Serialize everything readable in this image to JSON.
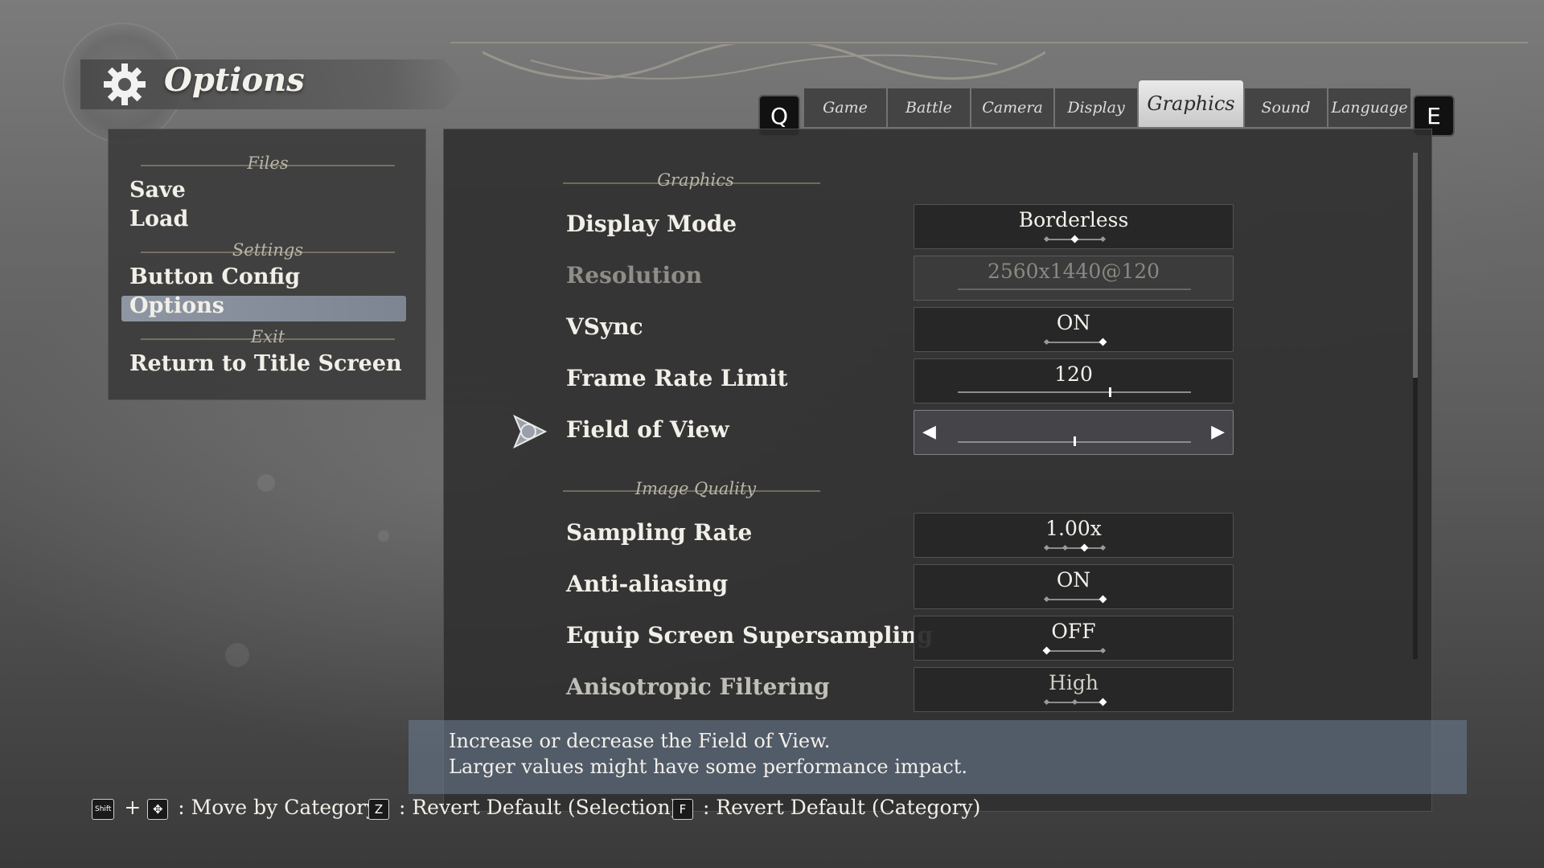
{
  "header": {
    "title": "Options",
    "icon": "gear-icon"
  },
  "side_menu": {
    "sections": {
      "files": "Files",
      "settings": "Settings",
      "exit": "Exit"
    },
    "items": {
      "save": "Save",
      "load": "Load",
      "button_config": "Button Config",
      "options": "Options",
      "return_title": "Return to Title Screen"
    },
    "selected": "Options"
  },
  "tabs": {
    "prev_key": "Q",
    "next_key": "E",
    "items": [
      "Game",
      "Battle",
      "Camera",
      "Display",
      "Graphics",
      "Sound",
      "Language"
    ],
    "active": "Graphics"
  },
  "main": {
    "groups": {
      "graphics": "Graphics",
      "image_quality": "Image Quality"
    },
    "settings": {
      "display_mode": {
        "label": "Display Mode",
        "value": "Borderless",
        "options_count": 3,
        "selected_index": 1
      },
      "resolution": {
        "label": "Resolution",
        "value": "2560x1440@120",
        "enabled": false
      },
      "vsync": {
        "label": "VSync",
        "value": "ON",
        "options_count": 2,
        "selected_index": 1
      },
      "frame_rate_limit": {
        "label": "Frame Rate Limit",
        "value": "120",
        "level": 0.65
      },
      "field_of_view": {
        "label": "Field of View",
        "level": 0.5
      },
      "sampling_rate": {
        "label": "Sampling Rate",
        "value": "1.00x",
        "options_count": 4,
        "selected_index": 2
      },
      "anti_aliasing": {
        "label": "Anti-aliasing",
        "value": "ON",
        "options_count": 2,
        "selected_index": 1
      },
      "equip_supersampling": {
        "label": "Equip Screen Supersampling",
        "value": "OFF",
        "options_count": 2,
        "selected_index": 0
      },
      "anisotropic_filtering": {
        "label": "Anisotropic Filtering",
        "value": "High",
        "options_count": 3,
        "selected_index": 2
      }
    }
  },
  "description": {
    "line1": "Increase or decrease the Field of View.",
    "line2": "Larger values might have some performance impact."
  },
  "footer": {
    "hint1_key": "Shift",
    "hint1_text": ": Move by Category",
    "hint2_key": "Z",
    "hint2_text": ": Revert Default (Selection)",
    "hint3_key": "F",
    "hint3_text": ": Revert Default (Category)"
  }
}
